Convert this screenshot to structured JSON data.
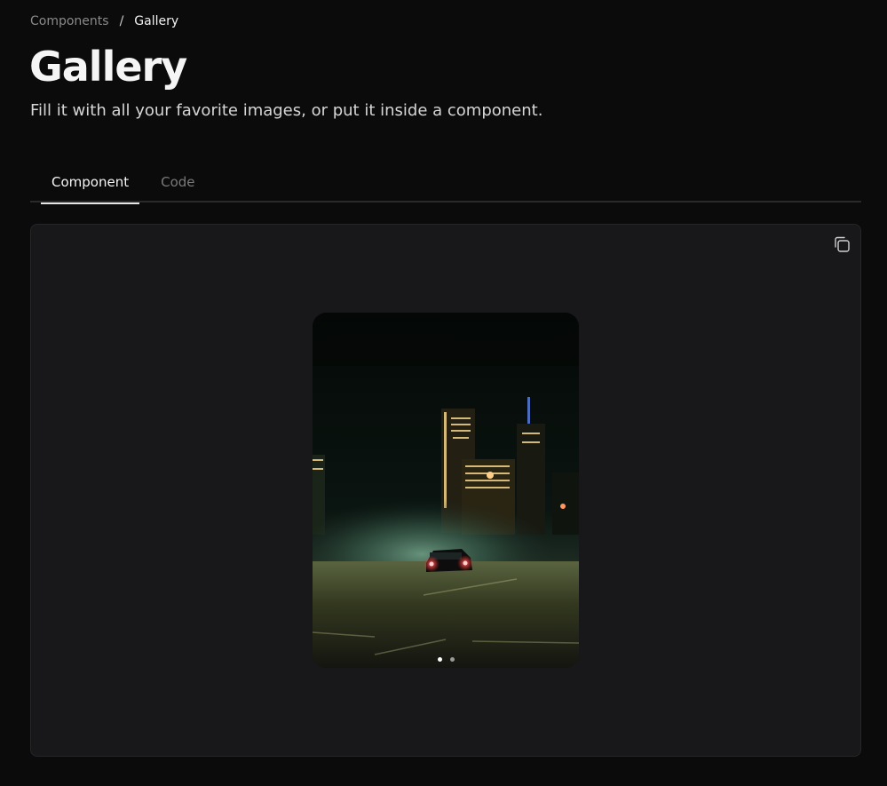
{
  "breadcrumb": {
    "parent": "Components",
    "separator": "/",
    "current": "Gallery"
  },
  "page": {
    "title": "Gallery",
    "subtitle": "Fill it with all your favorite images, or put it inside a component."
  },
  "tabs": [
    {
      "label": "Component",
      "active": true
    },
    {
      "label": "Code",
      "active": false
    }
  ],
  "preview": {
    "copy_icon": "copy-icon",
    "gallery": {
      "slide_count": 2,
      "active_slide": 1
    }
  },
  "colors": {
    "background": "#0b0b0b",
    "panel": "#18181a",
    "text_primary": "#f5f5f5",
    "text_muted": "#7a7a7a"
  }
}
